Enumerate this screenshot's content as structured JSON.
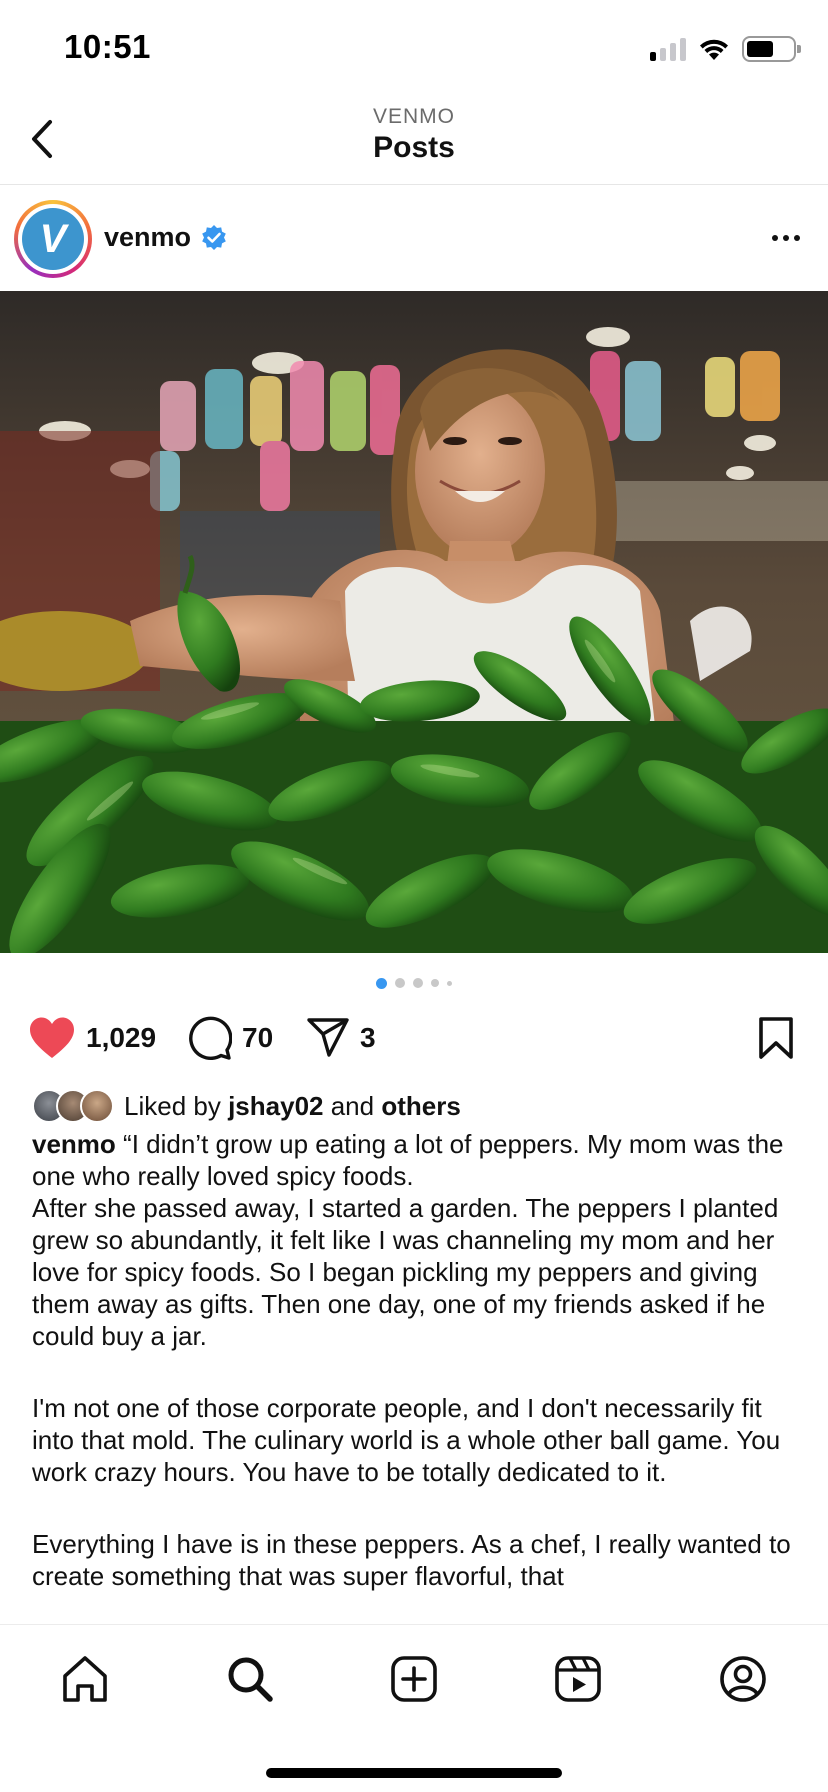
{
  "status_bar": {
    "time": "10:51",
    "icons": [
      "cellular-signal-icon",
      "wifi-icon",
      "battery-icon"
    ]
  },
  "header": {
    "subtitle": "VENMO",
    "title": "Posts",
    "back_icon": "chevron-left-icon"
  },
  "post": {
    "username": "venmo",
    "verified": true,
    "avatar_letter": "V",
    "more_icon": "more-horizontal-icon",
    "image": {
      "carousel_count": 5,
      "carousel_active_index": 0
    },
    "actions": {
      "likes": "1,029",
      "comments": "70",
      "shares": "3"
    },
    "liked_by": {
      "prefix": "Liked by",
      "user": "jshay02",
      "connector": "and",
      "others": "others"
    },
    "caption": {
      "username": "venmo",
      "first_line": "“I didn’t grow up eating a lot of peppers. My mom was the one who really loved spicy foods.",
      "paragraph_1_rest": "After she passed away, I started a garden. The peppers I planted grew so abundantly, it felt like I was channeling my mom and her love for spicy foods. So I began pickling my peppers and giving them away as gifts. Then one day, one of my friends asked if he could buy a jar.",
      "paragraph_2": "I'm not one of those corporate people, and I don't necessarily fit into that mold. The culinary world is a whole other ball game. You work crazy hours. You have to be totally dedicated to it.",
      "paragraph_3": "Everything I have is in these peppers. As a chef, I really wanted to create something that was super flavorful, that"
    }
  },
  "bottom_nav": {
    "items": [
      "home-icon",
      "search-icon",
      "create-post-icon",
      "reels-icon",
      "profile-icon"
    ]
  },
  "colors": {
    "like_red": "#ed4956",
    "verified_blue": "#3897f0",
    "carousel_active": "#3897f0",
    "venmo_blue": "#3d95ce"
  }
}
